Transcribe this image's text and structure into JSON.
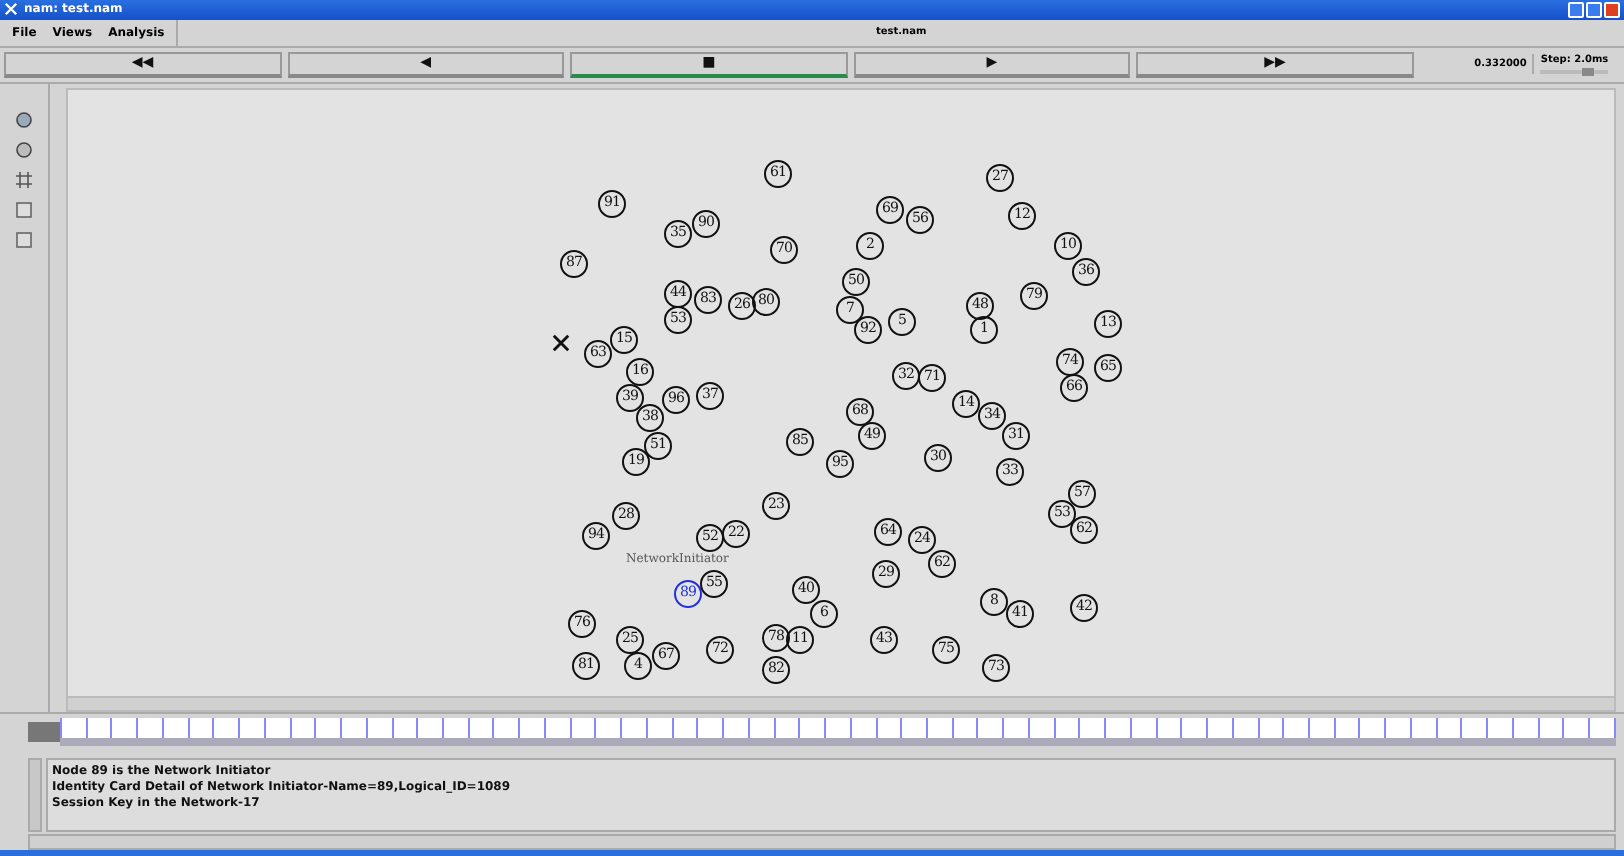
{
  "window": {
    "title": "nam: test.nam"
  },
  "menu": [
    {
      "label": "File"
    },
    {
      "label": "Views"
    },
    {
      "label": "Analysis"
    }
  ],
  "file_name": "test.nam",
  "controls": [
    {
      "label": "◀◀",
      "selected": false
    },
    {
      "label": "◀",
      "selected": false
    },
    {
      "label": "■",
      "selected": true
    },
    {
      "label": "▶",
      "selected": false
    },
    {
      "label": "▶▶",
      "selected": false
    }
  ],
  "time": "0.332000",
  "step": {
    "label": "Step: 2.0ms",
    "level": 0.7
  },
  "nodes": [
    {
      "label": "61",
      "kind": "node"
    },
    {
      "label": "91",
      "kind": "node"
    },
    {
      "label": "35",
      "kind": "node"
    },
    {
      "label": "90",
      "kind": "node"
    },
    {
      "label": "87",
      "kind": "node"
    },
    {
      "label": "70",
      "kind": "node"
    },
    {
      "label": "44",
      "kind": "node"
    },
    {
      "label": "53",
      "kind": "node"
    },
    {
      "label": "83",
      "kind": "node"
    },
    {
      "label": "26",
      "kind": "node"
    },
    {
      "label": "80",
      "kind": "node"
    },
    {
      "label": "63",
      "kind": "node"
    },
    {
      "label": "15",
      "kind": "node"
    },
    {
      "label": "16",
      "kind": "node"
    },
    {
      "label": "39",
      "kind": "node"
    },
    {
      "label": "38",
      "kind": "node"
    },
    {
      "label": "96",
      "kind": "node"
    },
    {
      "label": "37",
      "kind": "node"
    },
    {
      "label": "27",
      "kind": "node"
    },
    {
      "label": "12",
      "kind": "node"
    },
    {
      "label": "69",
      "kind": "node"
    },
    {
      "label": "56",
      "kind": "node"
    },
    {
      "label": "2",
      "kind": "node"
    },
    {
      "label": "10",
      "kind": "node"
    },
    {
      "label": "36",
      "kind": "node"
    },
    {
      "label": "50",
      "kind": "node"
    },
    {
      "label": "7",
      "kind": "node"
    },
    {
      "label": "92",
      "kind": "node"
    },
    {
      "label": "5",
      "kind": "node"
    },
    {
      "label": "48",
      "kind": "node"
    },
    {
      "label": "1",
      "kind": "node"
    },
    {
      "label": "79",
      "kind": "node"
    },
    {
      "label": "13",
      "kind": "node"
    },
    {
      "label": "74",
      "kind": "node"
    },
    {
      "label": "66",
      "kind": "node"
    },
    {
      "label": "65",
      "kind": "node"
    },
    {
      "label": "32",
      "kind": "node"
    },
    {
      "label": "71",
      "kind": "node"
    },
    {
      "label": "14",
      "kind": "node"
    },
    {
      "label": "34",
      "kind": "node"
    },
    {
      "label": "51",
      "kind": "node"
    },
    {
      "label": "19",
      "kind": "node"
    },
    {
      "label": "85",
      "kind": "node"
    },
    {
      "label": "95",
      "kind": "node"
    },
    {
      "label": "23",
      "kind": "node"
    },
    {
      "label": "94",
      "kind": "node"
    },
    {
      "label": "28",
      "kind": "node"
    },
    {
      "label": "52",
      "kind": "node"
    },
    {
      "label": "22",
      "kind": "node"
    },
    {
      "label": "89",
      "kind": "initiator",
      "annotation": "NetworkInitiator"
    },
    {
      "label": "55",
      "kind": "node"
    },
    {
      "label": "40",
      "kind": "node"
    },
    {
      "label": "6",
      "kind": "node"
    },
    {
      "label": "76",
      "kind": "node"
    },
    {
      "label": "25",
      "kind": "node"
    },
    {
      "label": "4",
      "kind": "node"
    },
    {
      "label": "67",
      "kind": "node"
    },
    {
      "label": "81",
      "kind": "node"
    },
    {
      "label": "72",
      "kind": "node"
    },
    {
      "label": "78",
      "kind": "node"
    },
    {
      "label": "11",
      "kind": "node"
    },
    {
      "label": "82",
      "kind": "node"
    },
    {
      "label": "68",
      "kind": "node"
    },
    {
      "label": "49",
      "kind": "node"
    },
    {
      "label": "30",
      "kind": "node"
    },
    {
      "label": "31",
      "kind": "node"
    },
    {
      "label": "33",
      "kind": "node"
    },
    {
      "label": "57",
      "kind": "node"
    },
    {
      "label": "64",
      "kind": "node"
    },
    {
      "label": "24",
      "kind": "node"
    },
    {
      "label": "53",
      "kind": "node"
    },
    {
      "label": "62",
      "kind": "node"
    },
    {
      "label": "29",
      "kind": "node"
    },
    {
      "label": "62",
      "kind": "node"
    },
    {
      "label": "8",
      "kind": "node"
    },
    {
      "label": "41",
      "kind": "node"
    },
    {
      "label": "43",
      "kind": "node"
    },
    {
      "label": "75",
      "kind": "node"
    },
    {
      "label": "42",
      "kind": "node"
    },
    {
      "label": "73",
      "kind": "node"
    }
  ],
  "log": [
    "Node 89 is the Network Initiator",
    "Identity Card Detail of Network Initiator-Name=89,Logical_ID=1089",
    "Session Key in the Network-17"
  ]
}
